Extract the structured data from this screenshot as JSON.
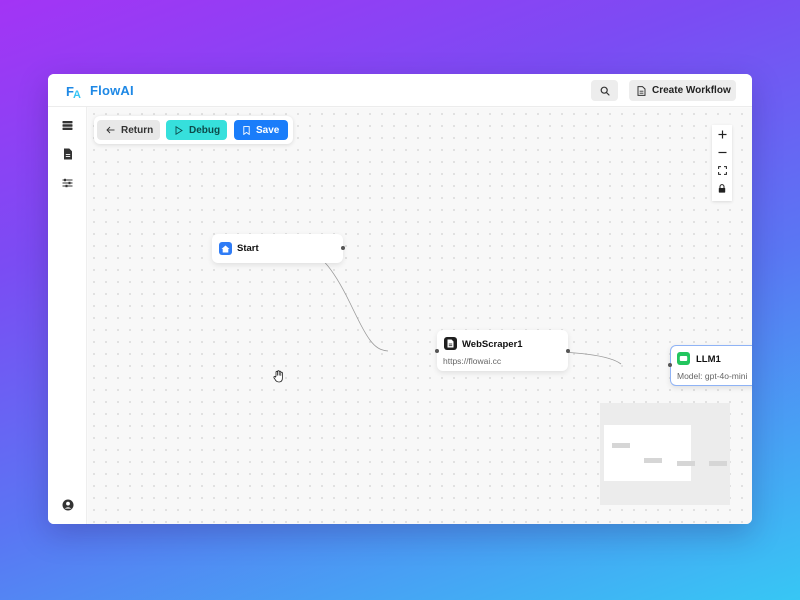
{
  "app": {
    "brand": "FlowAI",
    "logo_text": "FA"
  },
  "topbar": {
    "create_workflow_label": "Create Workflow",
    "search_icon": "search-icon",
    "create_icon": "document-icon"
  },
  "sidebar": {
    "items": [
      {
        "icon": "database-icon"
      },
      {
        "icon": "file-icon"
      },
      {
        "icon": "sliders-icon"
      }
    ],
    "bottom_icon": "user-circle-icon"
  },
  "toolbar": {
    "return_label": "Return",
    "debug_label": "Debug",
    "save_label": "Save"
  },
  "zoom_controls": [
    "zoom-in-icon",
    "zoom-out-icon",
    "fit-view-icon",
    "lock-icon"
  ],
  "nodes": {
    "start": {
      "title": "Start",
      "icon": "home-icon"
    },
    "webscraper": {
      "title": "WebScraper1",
      "subtitle": "https://flowai.cc",
      "icon": "document-icon"
    },
    "llm": {
      "title": "LLM1",
      "subtitle": "Model: gpt-4o-mini",
      "icon": "chat-icon"
    }
  },
  "colors": {
    "brand": "#1e88e5",
    "debug": "#36e0dc",
    "save": "#1a7dfa",
    "start_icon": "#2f7cf6",
    "llm_icon": "#22c55e",
    "llm_border": "#8fb3f5"
  }
}
